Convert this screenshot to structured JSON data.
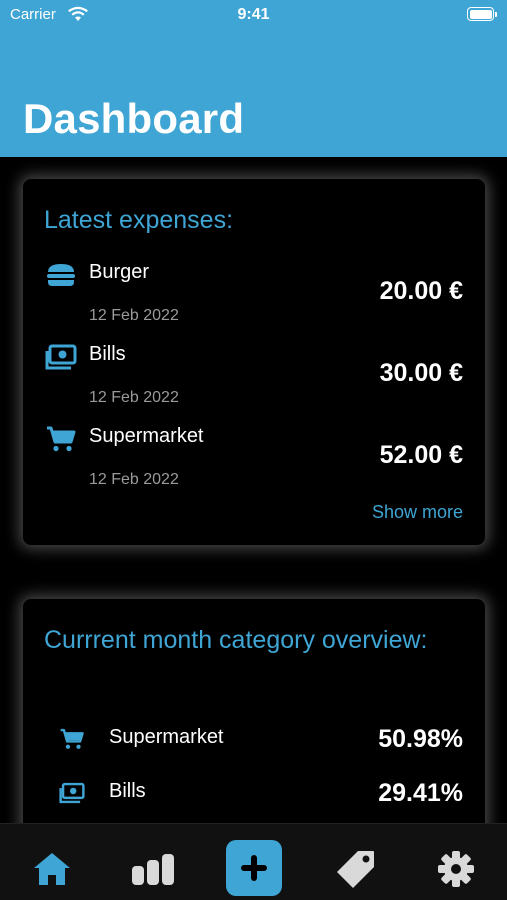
{
  "status_bar": {
    "carrier": "Carrier",
    "time": "9:41"
  },
  "header": {
    "title": "Dashboard"
  },
  "latest_expenses": {
    "title": "Latest expenses:",
    "items": [
      {
        "name": "Burger",
        "date": "12 Feb 2022",
        "amount": "20.00 €",
        "icon": "burger-icon"
      },
      {
        "name": "Bills",
        "date": "12 Feb 2022",
        "amount": "30.00 €",
        "icon": "money-icon"
      },
      {
        "name": "Supermarket",
        "date": "12 Feb 2022",
        "amount": "52.00 €",
        "icon": "cart-icon"
      }
    ],
    "show_more": "Show more"
  },
  "category_overview": {
    "title": "Currrent month category overview:",
    "items": [
      {
        "name": "Supermarket",
        "percent": "50.98%",
        "icon": "cart-icon"
      },
      {
        "name": "Bills",
        "percent": "29.41%",
        "icon": "money-icon"
      }
    ]
  },
  "tabbar": {
    "tabs": [
      "home-icon",
      "chart-icon",
      "add-icon",
      "tag-icon",
      "gear-icon"
    ],
    "active": "home"
  },
  "colors": {
    "accent": "#3fa5d4",
    "background": "#000000",
    "text": "#ffffff",
    "muted": "#9a9a9a"
  }
}
